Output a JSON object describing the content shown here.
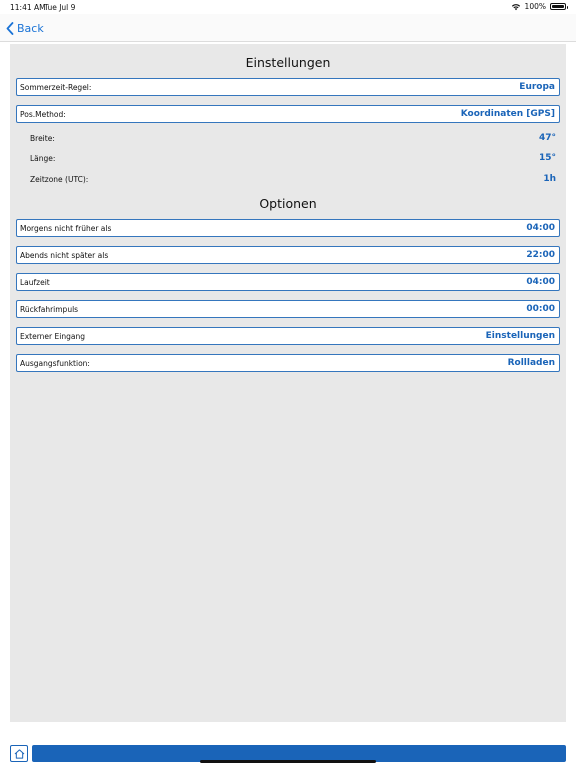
{
  "status": {
    "time": "11:41 AM",
    "date": "Tue Jul 9",
    "battery": "100%"
  },
  "nav": {
    "back_label": "Back"
  },
  "settings": {
    "title": "Einstellungen",
    "dst_rule": {
      "label": "Sommerzeit-Regel:",
      "value": "Europa"
    },
    "pos_method": {
      "label": "Pos.Method:",
      "value": "Koordinaten [GPS]"
    },
    "latitude": {
      "label": "Breite:",
      "value": "47°"
    },
    "longitude": {
      "label": "Länge:",
      "value": "15°"
    },
    "timezone": {
      "label": "Zeitzone (UTC):",
      "value": "1h"
    }
  },
  "options": {
    "title": "Optionen",
    "rows": [
      {
        "label": "Morgens nicht früher als",
        "value": "04:00"
      },
      {
        "label": "Abends nicht später als",
        "value": "22:00"
      },
      {
        "label": "Laufzeit",
        "value": "04:00"
      },
      {
        "label": "Rückfahrimpuls",
        "value": "00:00"
      },
      {
        "label": "Externer Eingang",
        "value": "Einstellungen"
      },
      {
        "label": "Ausgangsfunktion:",
        "value": "Rollladen"
      }
    ]
  },
  "icons": {
    "back": "chevron-left-icon",
    "home": "home-icon",
    "wifi": "wifi-icon",
    "battery": "battery-icon"
  },
  "colors": {
    "accent": "#1a64b8",
    "link": "#1a73d6",
    "panel_bg": "#e8e8e8",
    "row_border": "#3576bd"
  }
}
